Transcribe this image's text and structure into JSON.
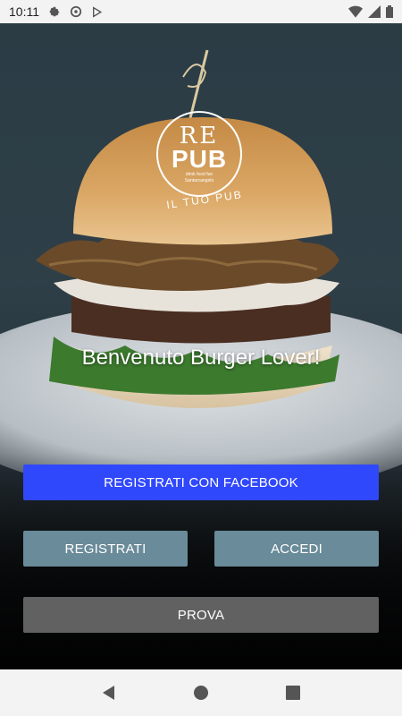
{
  "status_bar": {
    "time": "10:11",
    "left_icons": [
      "settings-icon",
      "at-sign-icon",
      "play-store-icon"
    ],
    "right_icons": [
      "wifi-icon",
      "signal-icon",
      "battery-icon"
    ]
  },
  "logo": {
    "line1": "RE",
    "line2": "PUB",
    "tagline1": "drink food fun",
    "tagline2": "Santarcangelo",
    "subtitle": "IL TUO PUB"
  },
  "welcome_text": "Benvenuto Burger Lover!",
  "buttons": {
    "facebook": "REGISTRATI CON FACEBOOK",
    "register": "REGISTRATI",
    "login": "ACCEDI",
    "try": "PROVA"
  },
  "colors": {
    "facebook": "#3048fb",
    "secondary": "#6a8b99",
    "try": "#616161"
  },
  "nav_bar": {
    "icons": [
      "back-icon",
      "home-icon",
      "recents-icon"
    ]
  }
}
